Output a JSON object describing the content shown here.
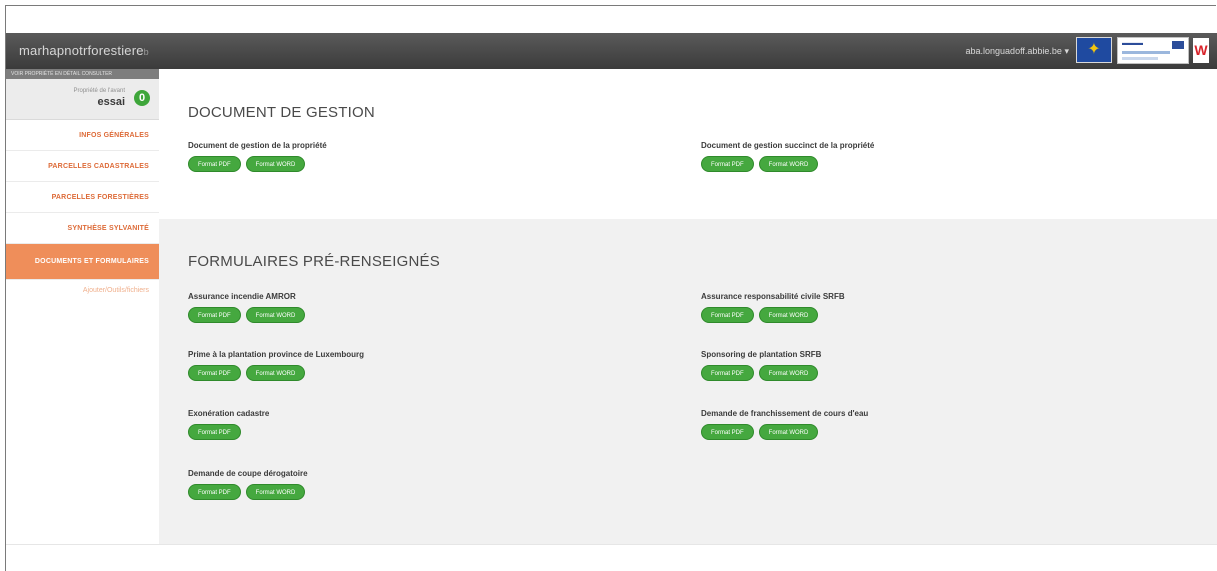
{
  "header": {
    "logo": "marhapnotrforestiere",
    "logo_suffix": "b",
    "user_email": "aba.longuadoff.abbie.be",
    "user_caret": "▾",
    "wallonie": "W"
  },
  "sidebar": {
    "top_bar_text": "VOIR PROPRIÉTÉ EN DÉTAIL CONSULTER",
    "owner_small": "Propriété de l'avant",
    "owner_name": "essai",
    "owner_badge": "0",
    "items": [
      {
        "label": "INFOS GÉNÉRALES"
      },
      {
        "label": "PARCELLES CADASTRALES"
      },
      {
        "label": "PARCELLES FORESTIÈRES"
      },
      {
        "label": "SYNTHÈSE SYLVANITÉ"
      },
      {
        "label": "DOCUMENTS ET FORMULAIRES"
      }
    ],
    "sub_item": "Ajouter/Outils/fichiers"
  },
  "document_gestion": {
    "title": "DOCUMENT DE GESTION",
    "items": [
      {
        "title": "Document de gestion de la propriété",
        "buttons": [
          "Format PDF",
          "Format WORD"
        ]
      },
      {
        "title": "Document de gestion succinct de la propriété",
        "buttons": [
          "Format PDF",
          "Format WORD"
        ]
      }
    ]
  },
  "formulaires": {
    "title": "FORMULAIRES PRÉ-RENSEIGNÉS",
    "items": [
      {
        "title": "Assurance incendie AMROR",
        "buttons": [
          "Format PDF",
          "Format WORD"
        ]
      },
      {
        "title": "Assurance responsabilité civile SRFB",
        "buttons": [
          "Format PDF",
          "Format WORD"
        ]
      },
      {
        "title": "Prime à la plantation province de Luxembourg",
        "buttons": [
          "Format PDF",
          "Format WORD"
        ]
      },
      {
        "title": "Sponsoring de plantation SRFB",
        "buttons": [
          "Format PDF",
          "Format WORD"
        ]
      },
      {
        "title": "Exonération cadastre",
        "buttons": [
          "Format PDF"
        ]
      },
      {
        "title": "Demande de franchissement de cours d'eau",
        "buttons": [
          "Format PDF",
          "Format WORD"
        ]
      },
      {
        "title": "Demande de coupe dérogatoire",
        "buttons": [
          "Format PDF",
          "Format WORD"
        ]
      }
    ]
  },
  "colors": {
    "topbar": "#3b3b3b",
    "accent_orange": "#ef8e5a",
    "nav_text": "#dd6a37",
    "button_green": "#45a83f"
  },
  "icons": {
    "eu_flag": "eu-flag-icon",
    "interreg": "interreg-logo",
    "wallonie": "wallonie-logo-icon"
  }
}
